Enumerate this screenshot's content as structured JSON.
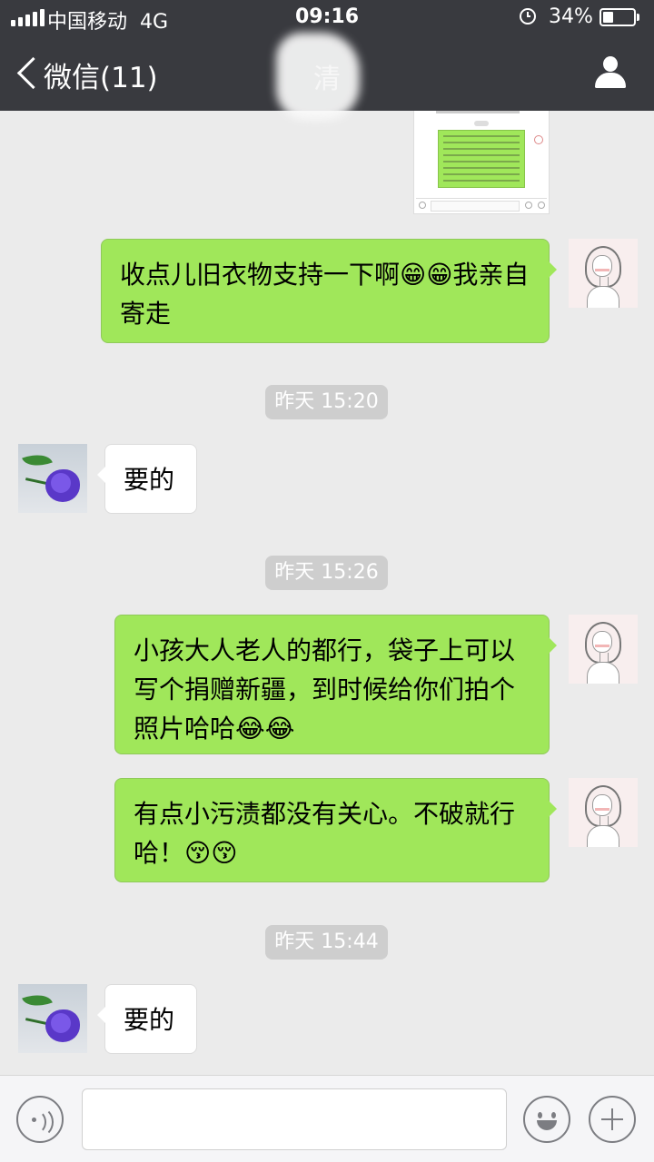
{
  "status_bar": {
    "carrier": "中国移动",
    "network": "4G",
    "time": "09:16",
    "battery": "34%",
    "battery_level": 0.34
  },
  "nav": {
    "back_label": "微信(11)",
    "title": "清"
  },
  "messages": {
    "m1": {
      "text": "收点儿旧衣物支持一下啊😁😁我亲自寄走"
    },
    "t1": {
      "text": "昨天 15:20"
    },
    "m2": {
      "text": "要的"
    },
    "t2": {
      "text": "昨天 15:26"
    },
    "m3": {
      "text": "小孩大人老人的都行，袋子上可以写个捐赠新疆，到时候给你们拍个照片哈哈😂😂"
    },
    "m4": {
      "text": "有点小污渍都没有关心。不破就行哈！😚😚"
    },
    "t3": {
      "text": "昨天 15:44"
    },
    "m5": {
      "text": "要的"
    }
  },
  "colors": {
    "nav_bg": "#393a3f",
    "chat_bg": "#ebebeb",
    "outgoing_bubble": "#a0e75a",
    "incoming_bubble": "#ffffff",
    "time_pill": "#cecece"
  },
  "icons": {
    "back": "chevron-left-icon",
    "profile": "person-icon",
    "voice": "voice-icon",
    "emoji": "smiley-icon",
    "more": "plus-icon"
  }
}
